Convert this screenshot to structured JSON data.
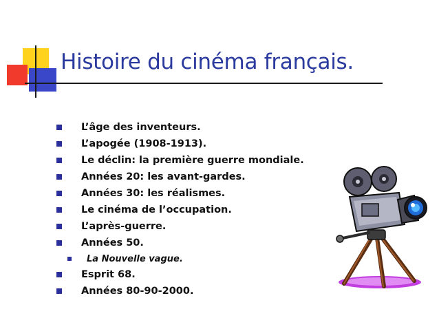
{
  "slide": {
    "title": "Histoire du cinéma français.",
    "bullets": [
      {
        "text": "L’âge des inventeurs.",
        "level": 1
      },
      {
        "text": "L’apogée (1908-1913).",
        "level": 1
      },
      {
        "text": "Le déclin: la première guerre mondiale.",
        "level": 1
      },
      {
        "text": "Années 20: les avant-gardes.",
        "level": 1
      },
      {
        "text": "Années 30: les réalismes.",
        "level": 1
      },
      {
        "text": "Le cinéma de l’occupation.",
        "level": 1
      },
      {
        "text": "L’après-guerre.",
        "level": 1
      },
      {
        "text": "Années 50.",
        "level": 1
      },
      {
        "text": "La Nouvelle vague.",
        "level": 2
      },
      {
        "text": "Esprit 68.",
        "level": 1
      },
      {
        "text": "Années 80-90-2000.",
        "level": 1
      }
    ]
  },
  "colors": {
    "title": "#2b3a9e",
    "bullet_marker": "#2a2f9c",
    "deco_yellow": "#ffd21e",
    "deco_red": "#f13a2c",
    "deco_blue": "#3a47c8"
  },
  "icons": {
    "illustration": "movie-camera-icon"
  }
}
